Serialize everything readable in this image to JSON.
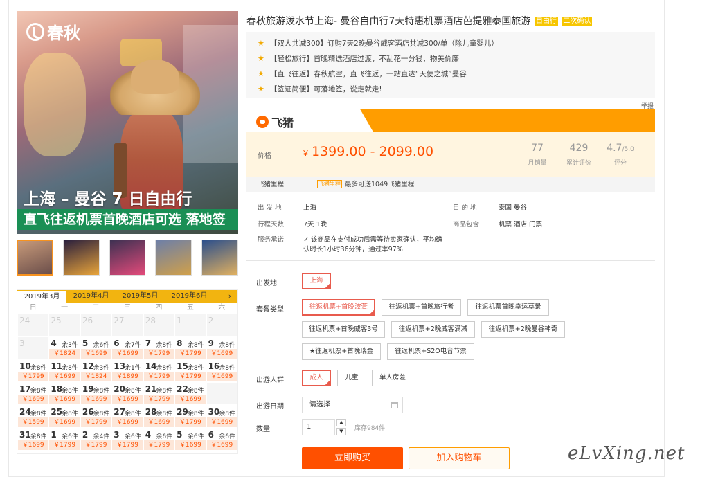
{
  "hero": {
    "logo_text": "春秋",
    "title": "上海 – 曼谷 7 日自由行",
    "subtitle": "直飞往返机票首晚酒店可选 落地签"
  },
  "thumbs": [
    "thumb-1",
    "thumb-2",
    "thumb-3",
    "thumb-4",
    "thumb-5"
  ],
  "thumb_colors": [
    [
      "#c79a7a",
      "#6b4e4a"
    ],
    [
      "#2a1f3d",
      "#e8a43a"
    ],
    [
      "#3e3152",
      "#e24a7a"
    ],
    [
      "#6d7fa8",
      "#d0a04a"
    ],
    [
      "#2c4f8c",
      "#e0b060"
    ]
  ],
  "calendar": {
    "tabs": [
      "2019年3月",
      "2019年4月",
      "2019年5月",
      "2019年6月"
    ],
    "next_icon": "›",
    "weekdays": [
      "日",
      "一",
      "二",
      "三",
      "四",
      "五",
      "六"
    ],
    "days": [
      {
        "d": "24",
        "s": "",
        "p": "",
        "past": true
      },
      {
        "d": "25",
        "s": "",
        "p": "",
        "past": true
      },
      {
        "d": "26",
        "s": "",
        "p": "",
        "past": true
      },
      {
        "d": "27",
        "s": "",
        "p": "",
        "past": true
      },
      {
        "d": "28",
        "s": "",
        "p": "",
        "past": true
      },
      {
        "d": "1",
        "s": "",
        "p": "",
        "past": true
      },
      {
        "d": "2",
        "s": "",
        "p": "",
        "past": true
      },
      {
        "d": "3",
        "s": "",
        "p": "",
        "past": true
      },
      {
        "d": "4",
        "s": "余3件",
        "p": "￥1824"
      },
      {
        "d": "5",
        "s": "余6件",
        "p": "￥1699"
      },
      {
        "d": "6",
        "s": "余7件",
        "p": "￥1699"
      },
      {
        "d": "7",
        "s": "余8件",
        "p": "￥1799"
      },
      {
        "d": "8",
        "s": "余8件",
        "p": "￥1799"
      },
      {
        "d": "9",
        "s": "余8件",
        "p": "￥1699"
      },
      {
        "d": "10",
        "s": "余8件",
        "p": "￥1799"
      },
      {
        "d": "11",
        "s": "余8件",
        "p": "￥1699"
      },
      {
        "d": "12",
        "s": "余3件",
        "p": "￥1824"
      },
      {
        "d": "13",
        "s": "余1件",
        "p": "￥1899"
      },
      {
        "d": "14",
        "s": "余8件",
        "p": "￥1799"
      },
      {
        "d": "15",
        "s": "余8件",
        "p": "￥1799"
      },
      {
        "d": "16",
        "s": "余8件",
        "p": "￥1699"
      },
      {
        "d": "17",
        "s": "余8件",
        "p": "￥1699"
      },
      {
        "d": "18",
        "s": "余8件",
        "p": "￥1699"
      },
      {
        "d": "19",
        "s": "余8件",
        "p": "￥1699"
      },
      {
        "d": "20",
        "s": "余8件",
        "p": "￥1699"
      },
      {
        "d": "21",
        "s": "余8件",
        "p": "￥1799"
      },
      {
        "d": "22",
        "s": "余8件",
        "p": "￥1699"
      },
      {
        "d": "",
        "s": "",
        "p": "",
        "past": true
      },
      {
        "d": "24",
        "s": "余8件",
        "p": "￥1599"
      },
      {
        "d": "25",
        "s": "余8件",
        "p": "￥1699"
      },
      {
        "d": "26",
        "s": "余8件",
        "p": "￥1799"
      },
      {
        "d": "27",
        "s": "余8件",
        "p": "￥1699"
      },
      {
        "d": "28",
        "s": "余8件",
        "p": "￥1699"
      },
      {
        "d": "29",
        "s": "余8件",
        "p": "￥1799"
      },
      {
        "d": "30",
        "s": "余8件",
        "p": "￥1699"
      },
      {
        "d": "31",
        "s": "余8件",
        "p": "￥1699"
      },
      {
        "d": "1",
        "s": "余6件",
        "p": "￥1799"
      },
      {
        "d": "2",
        "s": "余4件",
        "p": "￥1799"
      },
      {
        "d": "3",
        "s": "余6件",
        "p": "￥1799"
      },
      {
        "d": "4",
        "s": "余6件",
        "p": "￥1799"
      },
      {
        "d": "5",
        "s": "余6件",
        "p": "￥1699"
      },
      {
        "d": "6",
        "s": "余6件",
        "p": "￥1699"
      }
    ]
  },
  "product": {
    "title": "春秋旅游泼水节上海- 曼谷自由行7天特惠机票酒店芭提雅泰国旅游",
    "tag1": "自由行",
    "tag2": "二次确认",
    "promos": [
      "【双人共减300】订购7天2晚曼谷威客酒店共减300/单（除儿童婴儿）",
      "【轻松旅行】首晚精选酒店过渡，不乱花一分钱，物美价廉",
      "【直飞往返】春秋航空，直飞往返，一站直达“天使之城”曼谷",
      "【签证简便】可落地签，说走就走!"
    ],
    "report": "举报"
  },
  "fliggy": {
    "logo_text": "飞猪",
    "price_label": "价格",
    "currency": "￥",
    "price": "1399.00 - 2099.00",
    "sales": "77",
    "sales_label": "月销量",
    "reviews": "429",
    "reviews_label": "累计评价",
    "rating": "4.7",
    "rating_max": "/5.0",
    "rating_label": "评分",
    "miles_label": "飞猪里程",
    "miles_tag": "飞猪里程",
    "miles_text": "最多可送1049飞猪里程"
  },
  "info": {
    "departure_label": "出 发 地",
    "departure": "上海",
    "destination_label": "目 的 地",
    "destination": "泰国  曼谷",
    "days_label": "行程天数",
    "days": "7天  1晚",
    "includes_label": "商品包含",
    "includes": "机票  酒店  门票",
    "service_label": "服务承诺",
    "service_line1": "该商品在支付成功后需等待卖家确认，平均确",
    "service_line2": "认时长1小时36分钟，通过率97%"
  },
  "options": {
    "from_label": "出发地",
    "from_value": "上海",
    "package_label": "套餐类型",
    "packages": [
      "往返机票+首晚波萱",
      "往返机票+首晚旅行者",
      "往返机票首晚幸运草景",
      "往返机票+首晚威客3号",
      "往返机票+2晚威客满减",
      "往返机票+2晚曼谷神奇",
      "★往返机票+首晚瑞金",
      "往返机票+S2O电音节票"
    ],
    "people_label": "出游人群",
    "people": [
      "成人",
      "儿童",
      "单人房差"
    ],
    "date_label": "出游日期",
    "date_placeholder": "请选择",
    "qty_label": "数量",
    "qty": "1",
    "qty_up": "▲",
    "qty_down": "▼",
    "stock": "库存984件",
    "buy": "立即购买",
    "cart": "加入购物车"
  },
  "watermark": "eLvXing.net",
  "colors": {
    "accent": "#ff5000",
    "fliggy": "#ff9d00",
    "tab_gold": "#f2b410",
    "green": "#1a8f55",
    "select_red": "#e85b4d"
  }
}
